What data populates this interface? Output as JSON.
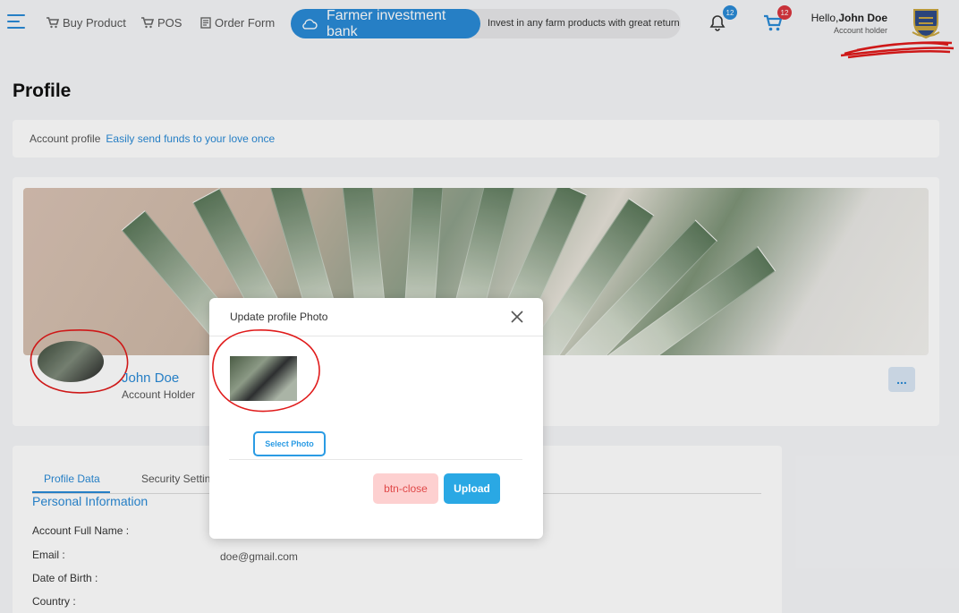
{
  "header": {
    "nav": [
      {
        "label": "Buy Product",
        "icon": "cart-icon"
      },
      {
        "label": "POS",
        "icon": "cart-icon"
      },
      {
        "label": "Order Form",
        "icon": "order-form-icon"
      }
    ],
    "brand": "Farmer investment bank",
    "tagline": "Invest in any farm products with great return",
    "notifications_count": "12",
    "cart_count": "12",
    "greeting": "Hello,",
    "user_name": "John Doe",
    "user_role": "Account holder"
  },
  "page": {
    "title": "Profile",
    "crumb_label": "Account profile",
    "crumb_link": "Easily send funds to your love once"
  },
  "profile": {
    "name": "John Doe",
    "role": "Account Holder",
    "more_label": "..."
  },
  "tabs": {
    "items": [
      "Profile Data",
      "Security Settin"
    ],
    "active": 0
  },
  "personal": {
    "title": "Personal Information",
    "fields": [
      {
        "label": "Account Full Name :",
        "value": ""
      },
      {
        "label": "Email :",
        "value": "doe@gmail.com"
      },
      {
        "label": "Date of Birth :",
        "value": ""
      },
      {
        "label": "Country :",
        "value": ""
      }
    ]
  },
  "modal": {
    "title": "Update profile Photo",
    "select_label": "Select Photo",
    "close_label": "btn-close",
    "upload_label": "Upload"
  },
  "colors": {
    "accent": "#2a8ad6",
    "upload": "#2aa8e4",
    "danger_bg": "#fdd0d0",
    "danger_text": "#e04848",
    "badge_blue": "#2a8ad6",
    "badge_red": "#d9363e",
    "annotation": "#e01b1b"
  }
}
